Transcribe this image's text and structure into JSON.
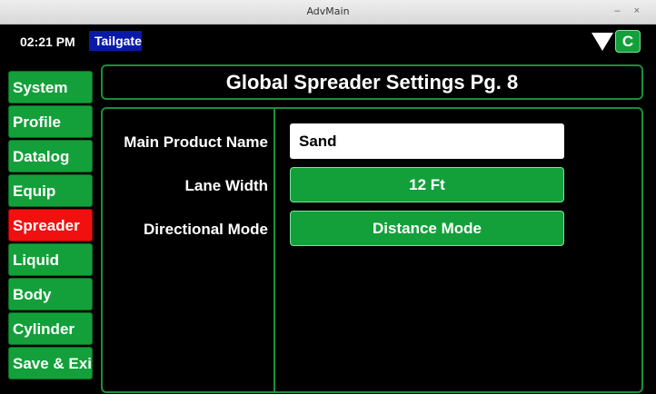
{
  "window": {
    "title": "AdvMain",
    "controls": "– ×"
  },
  "status": {
    "time": "02:21 PM",
    "mode_label": "Tailgate",
    "c_button": "C"
  },
  "sidebar": {
    "items": [
      {
        "label": "System"
      },
      {
        "label": "Profile"
      },
      {
        "label": "Datalog"
      },
      {
        "label": "Equip"
      },
      {
        "label": "Spreader"
      },
      {
        "label": "Liquid"
      },
      {
        "label": "Body"
      },
      {
        "label": "Cylinder"
      },
      {
        "label": "Save & Exit"
      }
    ],
    "active": "Spreader"
  },
  "page": {
    "title": "Global Spreader Settings Pg. 8"
  },
  "settings": {
    "main_product": {
      "label": "Main Product Name",
      "value": "Sand"
    },
    "lane_width": {
      "label": "Lane Width",
      "value": "12 Ft"
    },
    "directional_mode": {
      "label": "Directional Mode",
      "value": "Distance Mode"
    }
  },
  "colors": {
    "accent_green": "#13a03a",
    "active_red": "#f01010",
    "mode_blue": "#0a1aa8"
  }
}
